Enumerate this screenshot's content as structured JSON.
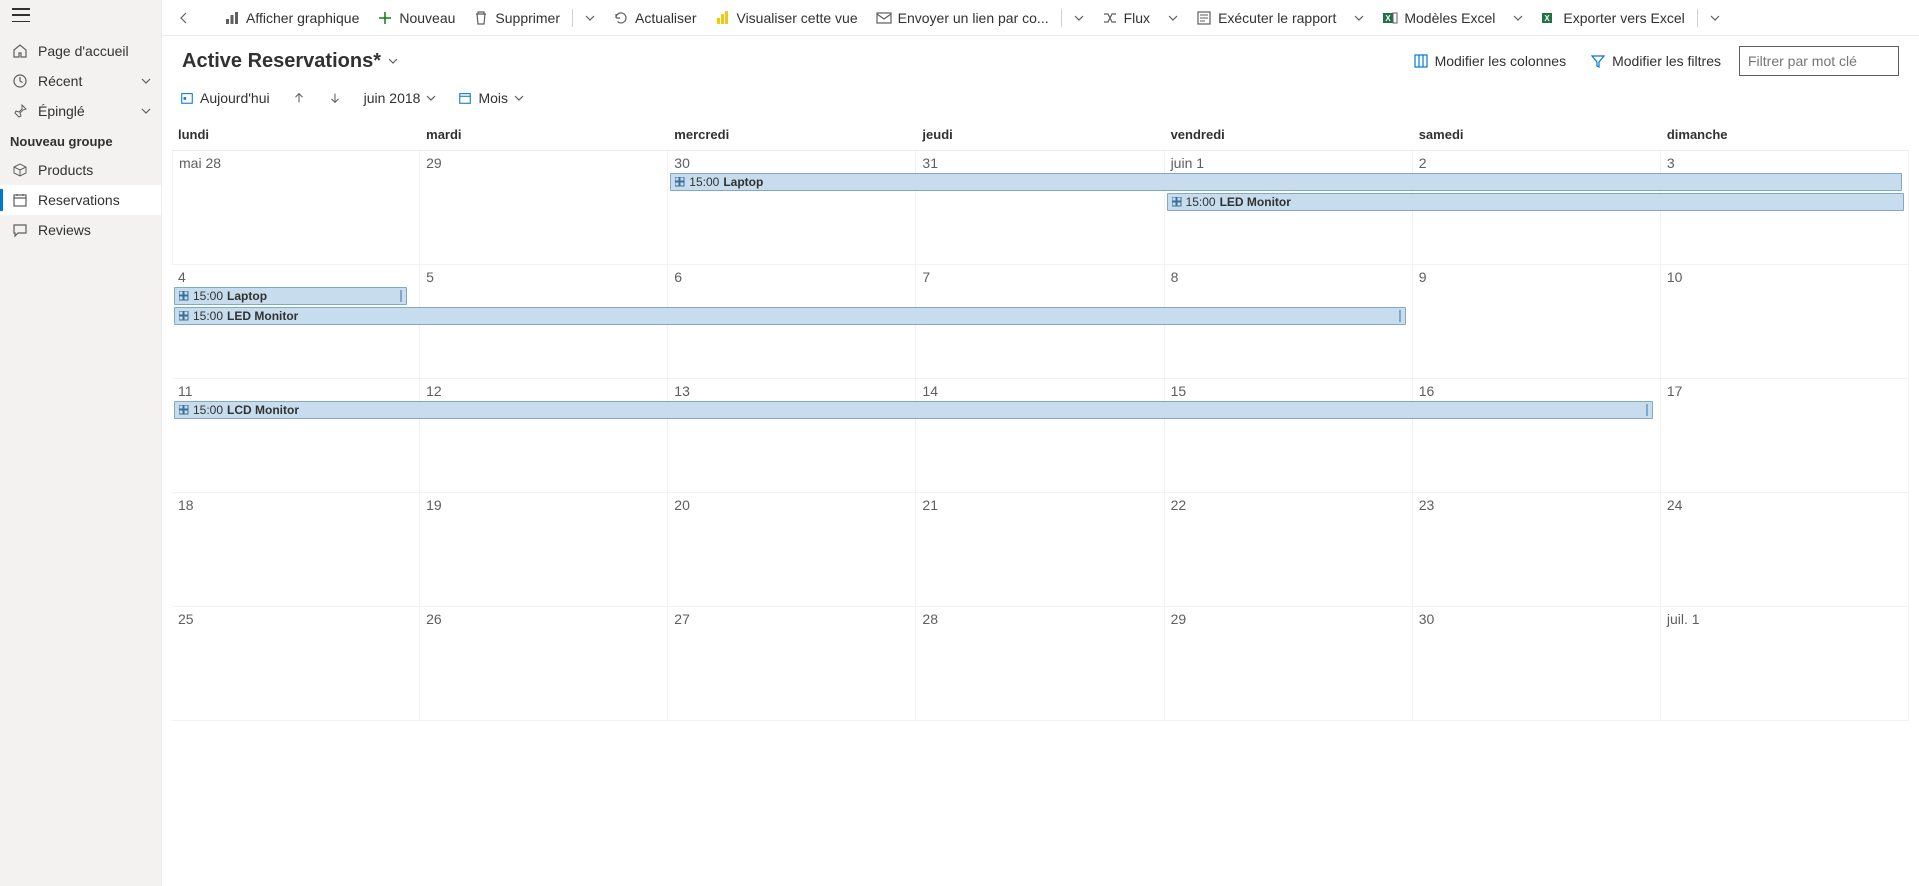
{
  "sidebar": {
    "home": "Page d'accueil",
    "recent": "Récent",
    "pinned": "Épinglé",
    "group_label": "Nouveau groupe",
    "products": "Products",
    "reservations": "Reservations",
    "reviews": "Reviews"
  },
  "cmd": {
    "show_chart": "Afficher graphique",
    "new": "Nouveau",
    "delete": "Supprimer",
    "refresh": "Actualiser",
    "visualize": "Visualiser cette vue",
    "email_link": "Envoyer un lien par co...",
    "flow": "Flux",
    "run_report": "Exécuter le rapport",
    "excel_templates": "Modèles Excel",
    "export_excel": "Exporter vers Excel"
  },
  "header": {
    "title": "Active Reservations*",
    "edit_columns": "Modifier les colonnes",
    "edit_filters": "Modifier les filtres",
    "filter_placeholder": "Filtrer par mot clé"
  },
  "toolbar": {
    "today": "Aujourd'hui",
    "month_year": "juin 2018",
    "view_mode": "Mois"
  },
  "days": {
    "mon": "lundi",
    "tue": "mardi",
    "wed": "mercredi",
    "thu": "jeudi",
    "fri": "vendredi",
    "sat": "samedi",
    "sun": "dimanche"
  },
  "dates": {
    "w1": [
      "mai 28",
      "29",
      "30",
      "31",
      "juin 1",
      "2",
      "3"
    ],
    "w2": [
      "4",
      "5",
      "6",
      "7",
      "8",
      "9",
      "10"
    ],
    "w3": [
      "11",
      "12",
      "13",
      "14",
      "15",
      "16",
      "17"
    ],
    "w4": [
      "18",
      "19",
      "20",
      "21",
      "22",
      "23",
      "24"
    ],
    "w5": [
      "25",
      "26",
      "27",
      "28",
      "29",
      "30",
      "juil. 1"
    ]
  },
  "events": {
    "e1_time": "15:00",
    "e1_name": "Laptop",
    "e2_time": "15:00",
    "e2_name": "LED Monitor",
    "e3_time": "15:00",
    "e3_name": "Laptop",
    "e4_time": "15:00",
    "e4_name": "LED Monitor",
    "e5_time": "15:00",
    "e5_name": "LCD Monitor"
  }
}
